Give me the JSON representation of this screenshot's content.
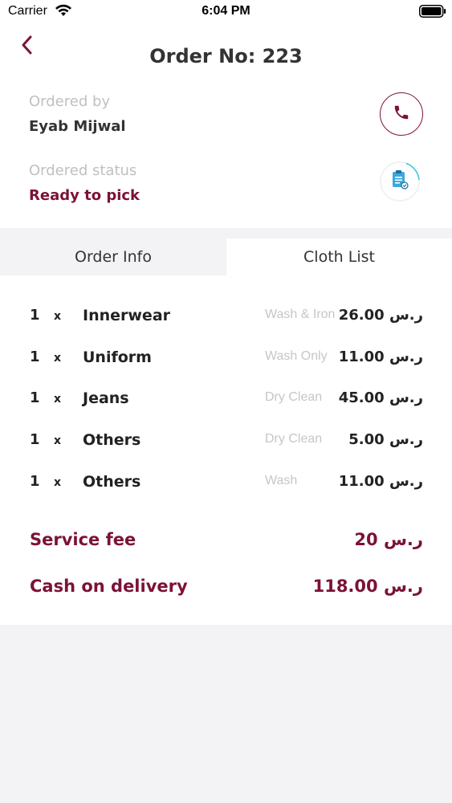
{
  "status_bar": {
    "carrier": "Carrier",
    "time": "6:04 PM"
  },
  "header": {
    "title": "Order No: 223",
    "ordered_by_label": "Ordered by",
    "ordered_by_value": "Eyab Mijwal",
    "status_label": "Ordered status",
    "status_value": "Ready to pick"
  },
  "tabs": [
    {
      "label": "Order Info",
      "active": false
    },
    {
      "label": "Cloth List",
      "active": true
    }
  ],
  "items": [
    {
      "qty": "1",
      "times": "x",
      "name": "Innerwear",
      "service": "Wash & Iron",
      "price": "26.00 ر.س"
    },
    {
      "qty": "1",
      "times": "x",
      "name": "Uniform",
      "service": "Wash Only",
      "price": "11.00 ر.س"
    },
    {
      "qty": "1",
      "times": "x",
      "name": "Jeans",
      "service": "Dry Clean",
      "price": "45.00 ر.س"
    },
    {
      "qty": "1",
      "times": "x",
      "name": "Others",
      "service": "Dry Clean",
      "price": "5.00 ر.س"
    },
    {
      "qty": "1",
      "times": "x",
      "name": "Others",
      "service": "Wash",
      "price": "11.00 ر.س"
    }
  ],
  "summary": {
    "service_fee_label": "Service fee",
    "service_fee_value": "20 ر.س",
    "cod_label": "Cash on delivery",
    "cod_value": "118.00 ر.س"
  },
  "colors": {
    "accent": "#7b1238",
    "status_ring": "#36c6e0",
    "background": "#f3f2f4"
  },
  "icons": [
    "wifi-icon",
    "battery-icon",
    "back-icon",
    "phone-icon",
    "clipboard-icon"
  ]
}
